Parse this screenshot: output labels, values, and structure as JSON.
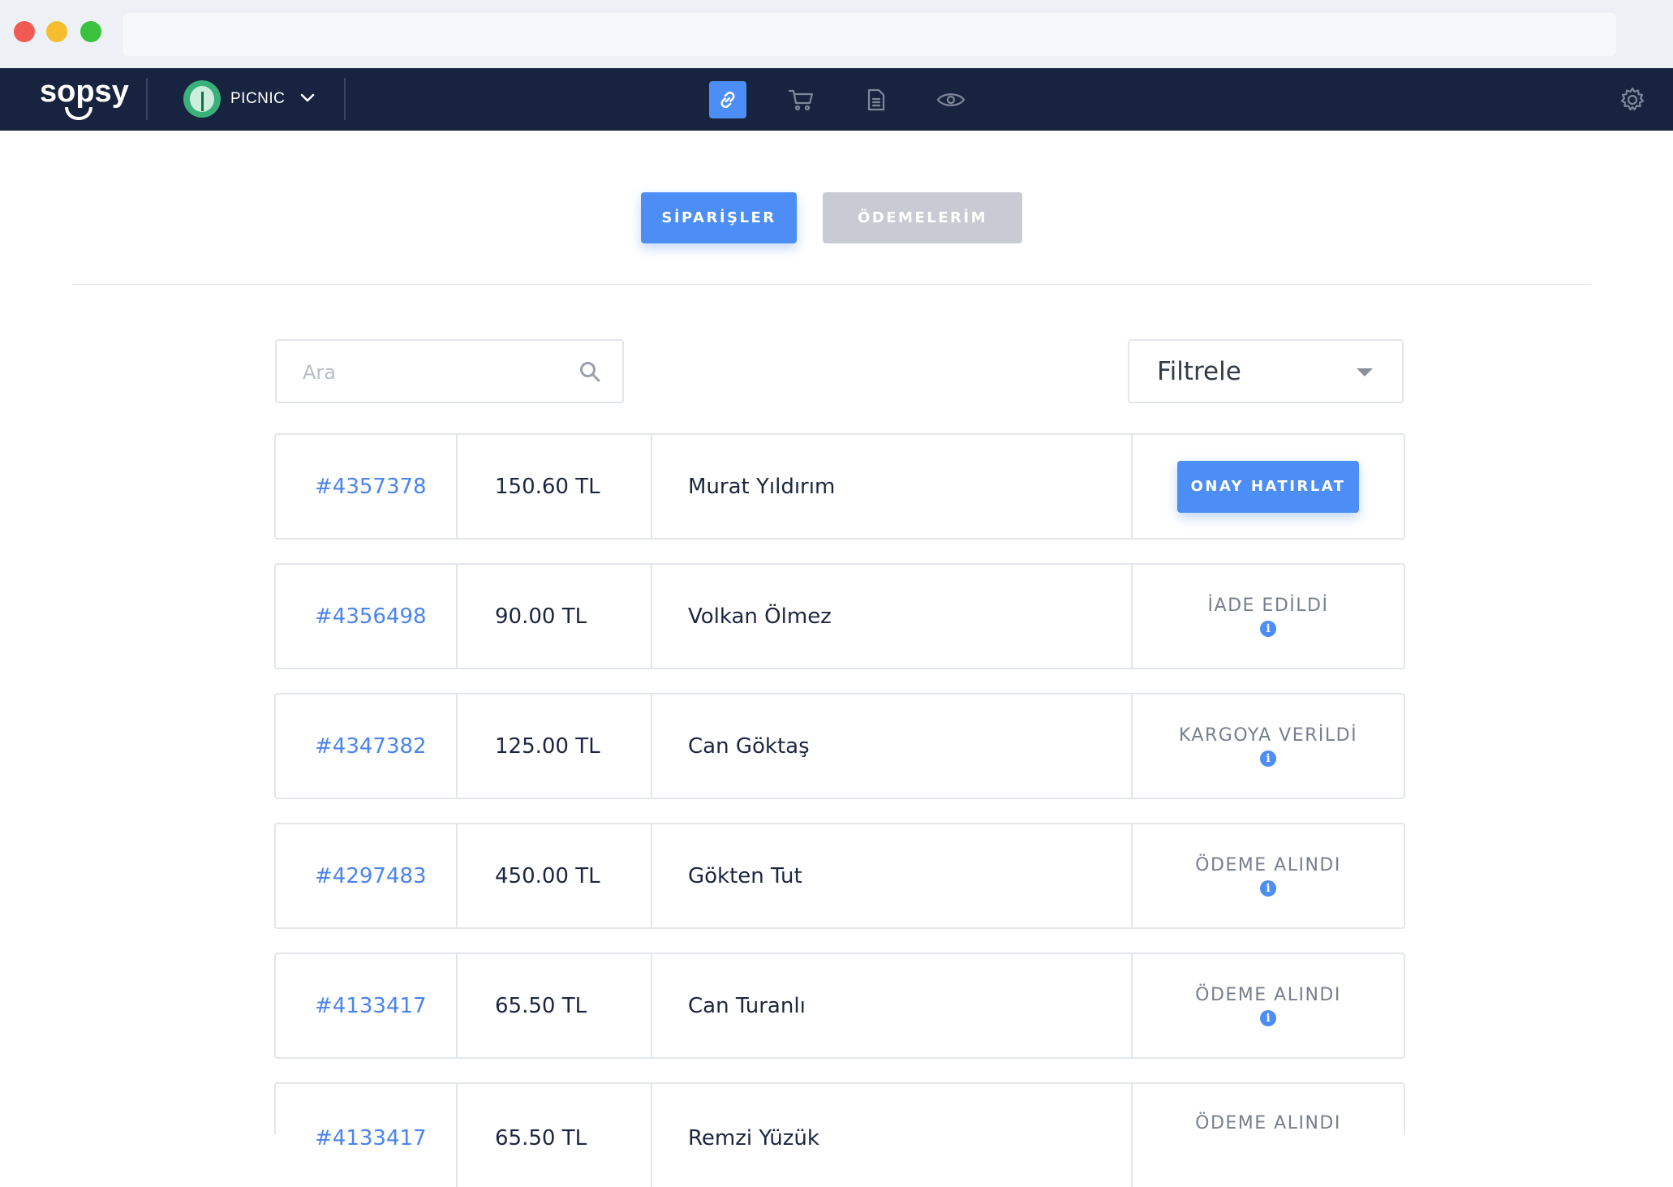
{
  "app": {
    "logo": "sopsy",
    "store_name": "PICNIC"
  },
  "tabs": {
    "orders": "SİPARİŞLER",
    "payments": "ÖDEMELERİM"
  },
  "search": {
    "placeholder": "Ara",
    "value": ""
  },
  "filter": {
    "label": "Filtrele"
  },
  "orders": [
    {
      "id": "#4357378",
      "amount": "150.60 TL",
      "customer": "Murat Yıldırım",
      "action": "ONAY HATIRLAT"
    },
    {
      "id": "#4356498",
      "amount": "90.00 TL",
      "customer": "Volkan Ölmez",
      "status": "İADE EDİLDİ"
    },
    {
      "id": "#4347382",
      "amount": "125.00 TL",
      "customer": "Can Göktaş",
      "status": "KARGOYA VERİLDİ"
    },
    {
      "id": "#4297483",
      "amount": "450.00 TL",
      "customer": "Gökten Tut",
      "status": "ÖDEME ALINDI"
    },
    {
      "id": "#4133417",
      "amount": "65.50 TL",
      "customer": "Can Turanlı",
      "status": "ÖDEME ALINDI"
    },
    {
      "id": "#4133417",
      "amount": "65.50 TL",
      "customer": "Remzi Yüzük",
      "status": "ÖDEME ALINDI"
    }
  ],
  "colors": {
    "nav_bg": "#18233f",
    "accent": "#4c8df6",
    "link": "#4a84ee",
    "muted_button": "#c8cbd3"
  },
  "icons": {
    "nav": [
      "link-icon",
      "cart-icon",
      "document-icon",
      "eye-icon"
    ],
    "settings": "gear-icon",
    "search": "search-icon",
    "status_info": "info-icon"
  }
}
